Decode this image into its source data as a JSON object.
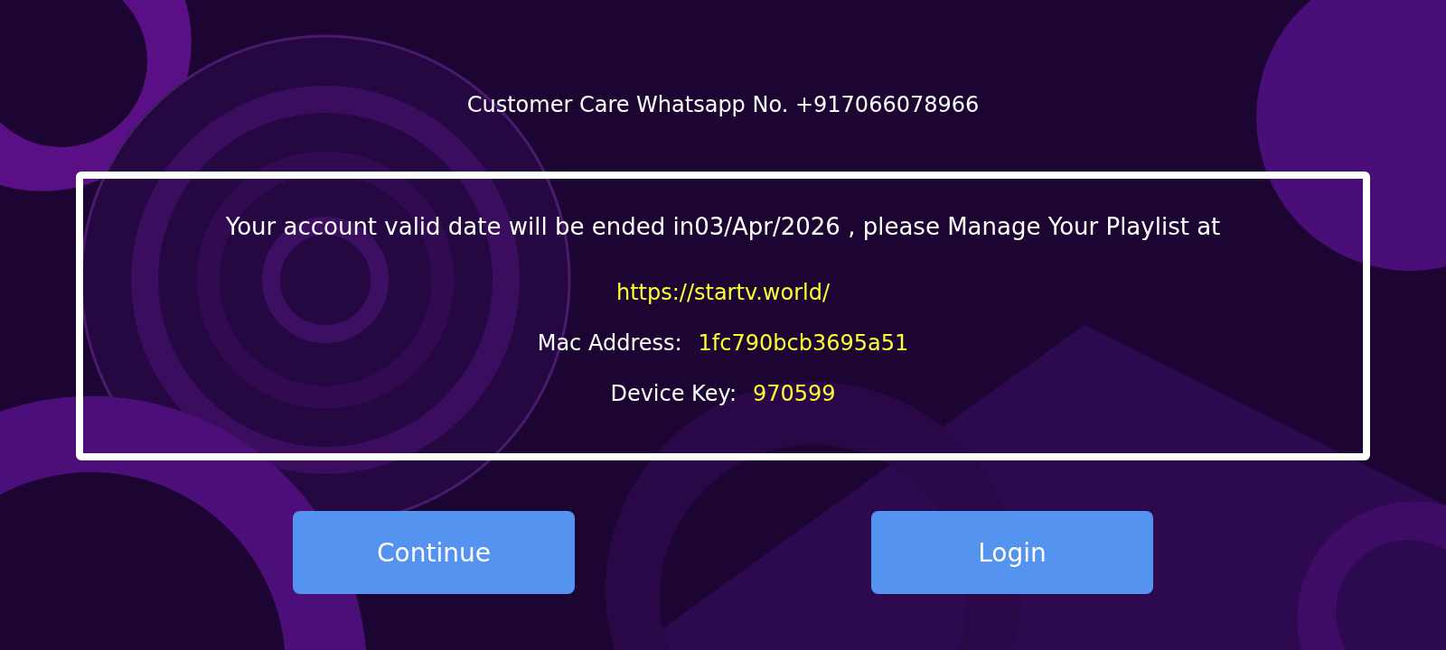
{
  "contact": "Customer Care Whatsapp No. +917066078966",
  "notice": {
    "message": "Your account valid date will be ended in03/Apr/2026 , please Manage Your Playlist at",
    "url": "https://startv.world/",
    "fields": [
      {
        "label": "Mac Address:",
        "value": "1fc790bcb3695a51"
      },
      {
        "label": "Device Key:",
        "value": "970599"
      }
    ]
  },
  "buttons": [
    {
      "label": "Continue"
    },
    {
      "label": "Login"
    }
  ]
}
